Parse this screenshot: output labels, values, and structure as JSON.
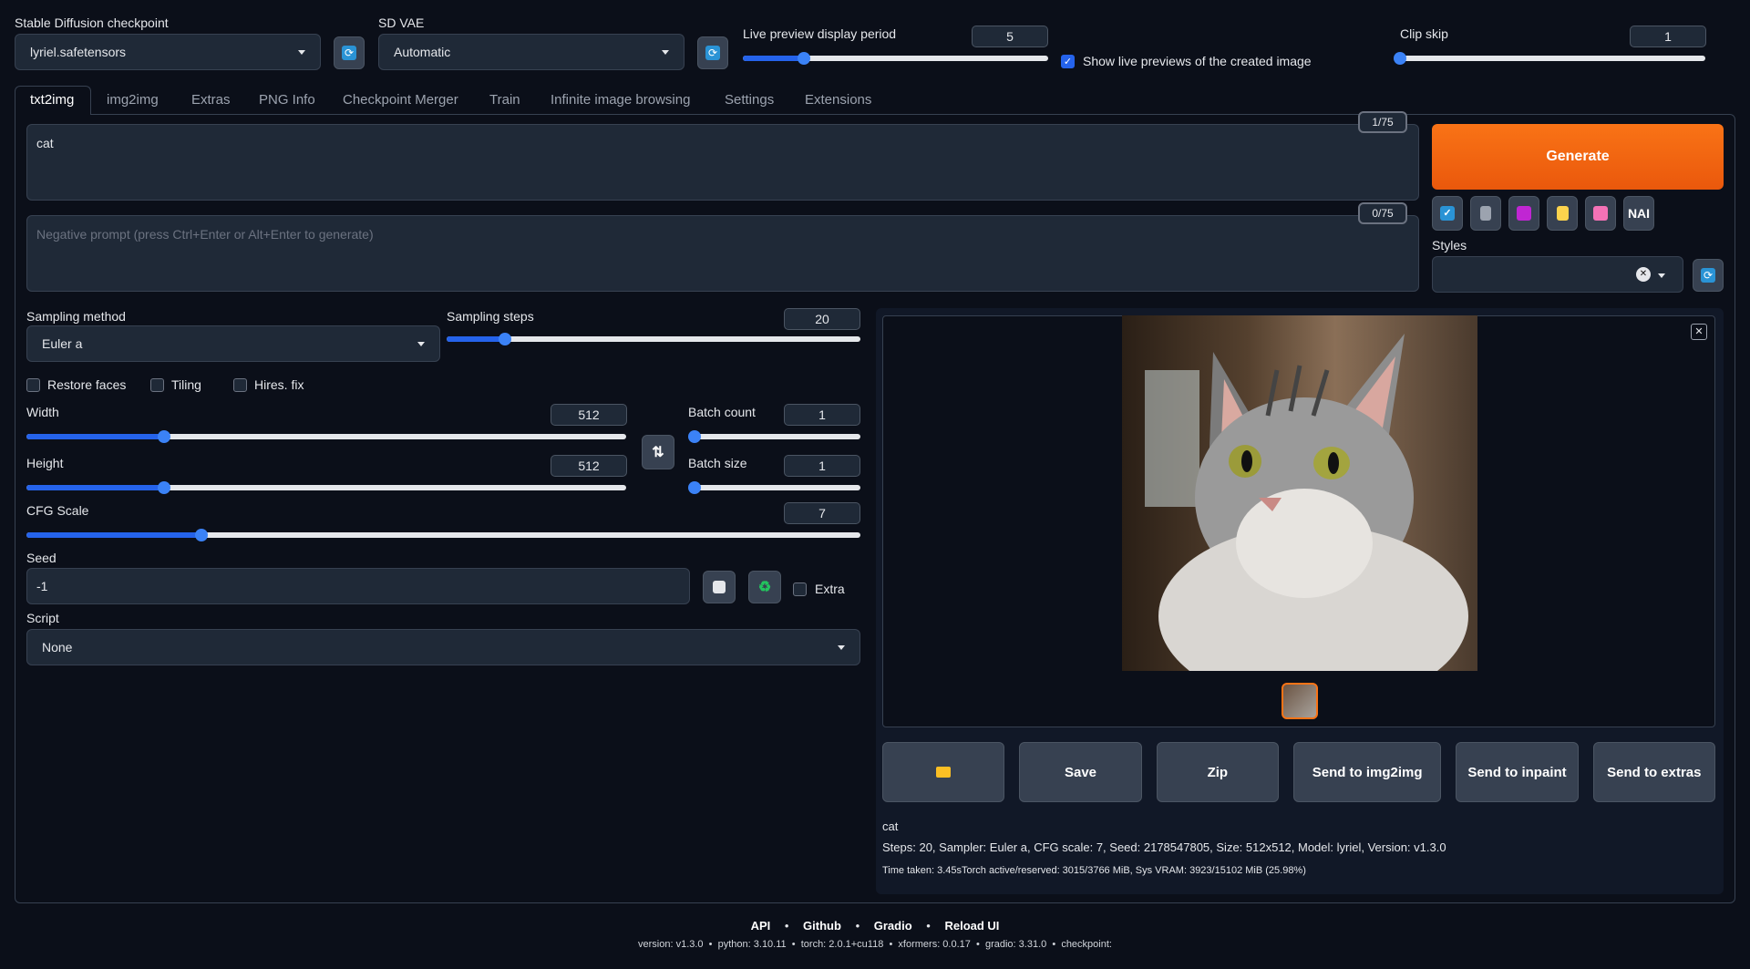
{
  "top": {
    "checkpoint_label": "Stable Diffusion checkpoint",
    "checkpoint_value": "lyriel.safetensors",
    "vae_label": "SD VAE",
    "vae_value": "Automatic",
    "live_preview_label": "Live preview display period",
    "live_preview_value": "5",
    "live_preview_level": 0.2,
    "show_live_label": "Show live previews of the created image",
    "show_live_checked": true,
    "clip_skip_label": "Clip skip",
    "clip_skip_value": "1",
    "clip_skip_level": 0.0
  },
  "tabs": [
    "txt2img",
    "img2img",
    "Extras",
    "PNG Info",
    "Checkpoint Merger",
    "Train",
    "Infinite image browsing",
    "Settings",
    "Extensions"
  ],
  "active_tab": "txt2img",
  "prompt": {
    "value": "cat",
    "counter": "1/75",
    "negative_placeholder": "Negative prompt (press Ctrl+Enter or Alt+Enter to generate)",
    "negative_counter": "0/75"
  },
  "generate": {
    "label": "Generate",
    "tools": [
      "checkbox-icon",
      "trash-icon",
      "pink-card-icon",
      "clipboard-icon",
      "save-icon"
    ],
    "nai_label": "NAI",
    "styles_label": "Styles",
    "styles_clear": "✕"
  },
  "params": {
    "sampling_method_label": "Sampling method",
    "sampling_method_value": "Euler a",
    "sampling_steps_label": "Sampling steps",
    "sampling_steps_value": "20",
    "sampling_steps_level": 0.14,
    "restore_faces_label": "Restore faces",
    "tiling_label": "Tiling",
    "hires_label": "Hires. fix",
    "width_label": "Width",
    "width_value": "512",
    "width_level": 0.23,
    "height_label": "Height",
    "height_value": "512",
    "height_level": 0.23,
    "batch_count_label": "Batch count",
    "batch_count_value": "1",
    "batch_count_level": 0.0,
    "batch_size_label": "Batch size",
    "batch_size_value": "1",
    "batch_size_level": 0.0,
    "cfg_label": "CFG Scale",
    "cfg_value": "7",
    "cfg_level": 0.21,
    "seed_label": "Seed",
    "seed_value": "-1",
    "extra_label": "Extra",
    "script_label": "Script",
    "script_value": "None"
  },
  "output": {
    "buttons": [
      "Save",
      "Zip",
      "Send to img2img",
      "Send to inpaint",
      "Send to extras"
    ],
    "info_prompt": "cat",
    "info_params": "Steps: 20, Sampler: Euler a, CFG scale: 7, Seed: 2178547805, Size: 512x512, Model: lyriel, Version: v1.3.0",
    "time_taken": "Time taken: 3.45sTorch active/reserved: 3015/3766 MiB, Sys VRAM: 3923/15102 MiB (25.98%)"
  },
  "footer": {
    "links": [
      "API",
      "Github",
      "Gradio",
      "Reload UI"
    ],
    "version_line": "version: v1.3.0  •  python: 3.10.11  •  torch: 2.0.1+cu118  •  xformers: 0.0.17  •  gradio: 3.31.0  •  checkpoint:"
  },
  "colors": {
    "accent": "#2563eb",
    "generate": "#f97316",
    "background": "#0b0f19",
    "panel": "#1f2937"
  }
}
